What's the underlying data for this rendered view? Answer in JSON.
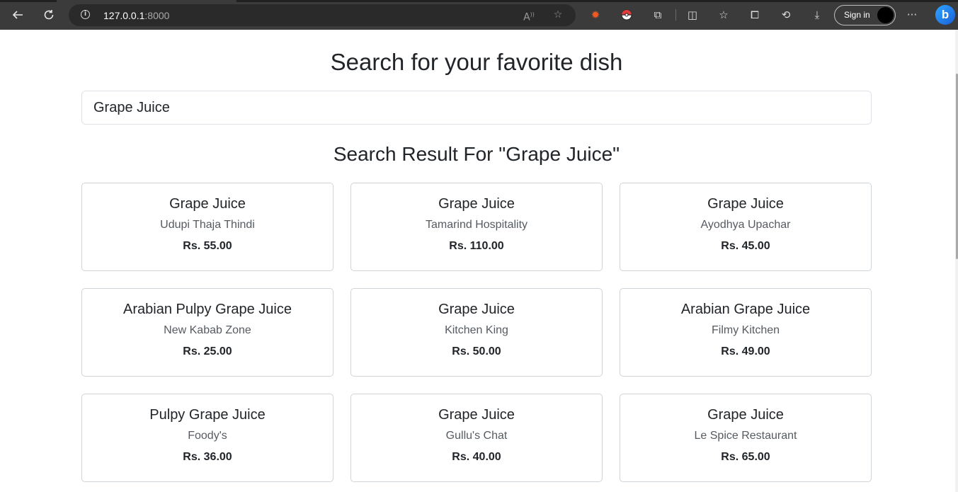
{
  "browser": {
    "url_host": "127.0.0.1",
    "url_port": ":8000",
    "sign_in_label": "Sign in",
    "icons": [
      "back-icon",
      "refresh-icon",
      "info-icon",
      "read-aloud-icon",
      "favorite-star-icon",
      "extension-orange-icon",
      "pokeball-extension-icon",
      "extensions-puzzle-icon",
      "split-screen-icon",
      "favorites-icon",
      "collections-icon",
      "history-icon",
      "downloads-icon",
      "more-icon",
      "bing-copilot-icon"
    ]
  },
  "page": {
    "title": "Search for your favorite dish",
    "search_value": "Grape Juice",
    "result_heading": "Search Result For \"Grape Juice\""
  },
  "results": [
    {
      "dish": "Grape Juice",
      "restaurant": "Udupi Thaja Thindi",
      "price": "Rs. 55.00"
    },
    {
      "dish": "Grape Juice",
      "restaurant": "Tamarind Hospitality",
      "price": "Rs. 110.00"
    },
    {
      "dish": "Grape Juice",
      "restaurant": "Ayodhya Upachar",
      "price": "Rs. 45.00"
    },
    {
      "dish": "Arabian Pulpy Grape Juice",
      "restaurant": "New Kabab Zone",
      "price": "Rs. 25.00"
    },
    {
      "dish": "Grape Juice",
      "restaurant": "Kitchen King",
      "price": "Rs. 50.00"
    },
    {
      "dish": "Arabian Grape Juice",
      "restaurant": "Filmy Kitchen",
      "price": "Rs. 49.00"
    },
    {
      "dish": "Pulpy Grape Juice",
      "restaurant": "Foody's",
      "price": "Rs. 36.00"
    },
    {
      "dish": "Grape Juice",
      "restaurant": "Gullu's Chat",
      "price": "Rs. 40.00"
    },
    {
      "dish": "Grape Juice",
      "restaurant": "Le Spice Restaurant",
      "price": "Rs. 65.00"
    }
  ],
  "colors": {
    "chrome_bg": "#3b3b3b",
    "address_bg": "#2a2a2a",
    "card_border": "#cfd4d9",
    "text": "#212529",
    "muted_text": "#555b61"
  }
}
